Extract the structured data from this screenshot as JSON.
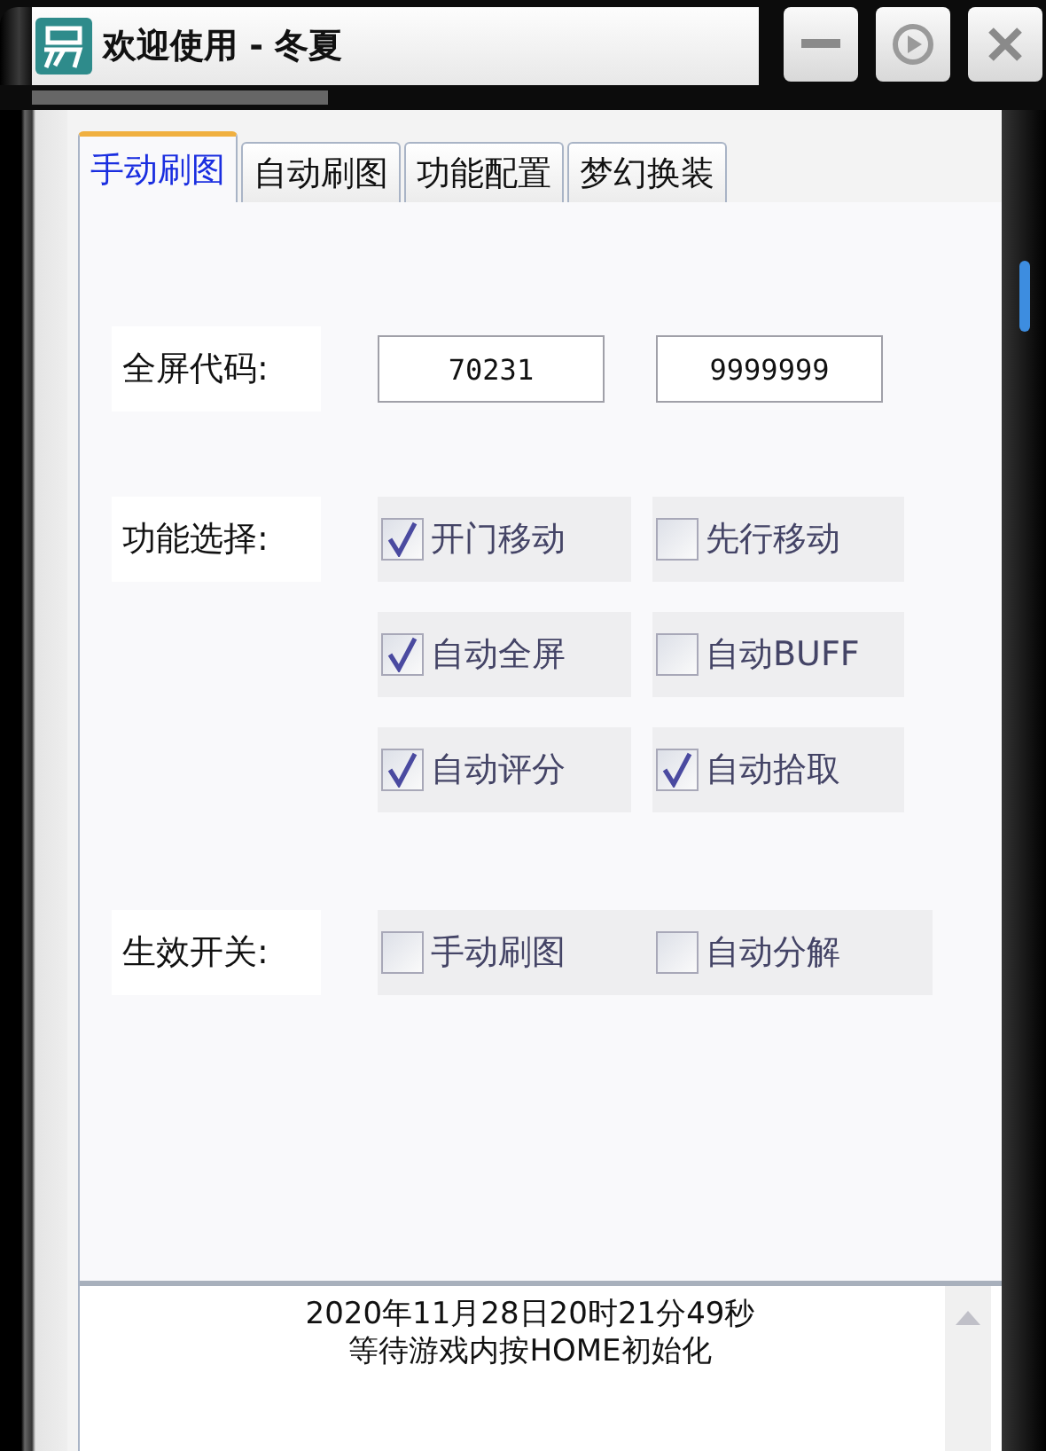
{
  "window": {
    "title": "欢迎使用 - 冬夏",
    "buttons": [
      {
        "kind": "minimize"
      },
      {
        "kind": "play"
      },
      {
        "kind": "close"
      }
    ]
  },
  "tabs": [
    {
      "label": "手动刷图",
      "selected": true
    },
    {
      "label": "自动刷图",
      "selected": false
    },
    {
      "label": "功能配置",
      "selected": false
    },
    {
      "label": "梦幻换装",
      "selected": false
    }
  ],
  "fullscreen_code": {
    "label": "全屏代码:",
    "values": [
      "70231",
      "9999999"
    ]
  },
  "features": {
    "label": "功能选择:",
    "options": [
      {
        "label": "开门移动",
        "checked": true
      },
      {
        "label": "先行移动",
        "checked": false
      },
      {
        "label": "自动全屏",
        "checked": true
      },
      {
        "label": "自动BUFF",
        "checked": false
      },
      {
        "label": "自动评分",
        "checked": true
      },
      {
        "label": "自动拾取",
        "checked": true
      }
    ]
  },
  "switches": {
    "label": "生效开关:",
    "options": [
      {
        "label": "手动刷图",
        "checked": false
      },
      {
        "label": "自动分解",
        "checked": false
      }
    ]
  },
  "log": {
    "lines": [
      "2020年11月28日20时21分49秒",
      "等待游戏内按HOME初始化"
    ]
  }
}
